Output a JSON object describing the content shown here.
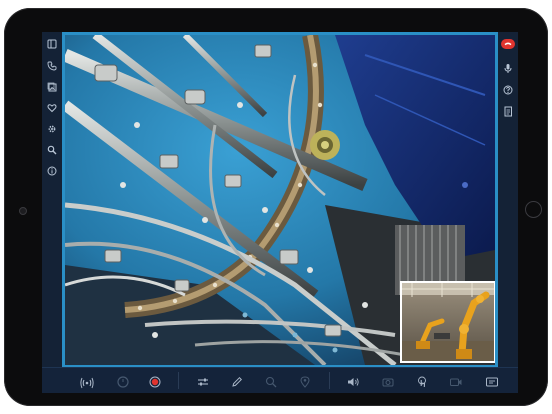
{
  "app": {
    "accent_color": "#2a8fc6",
    "record_color": "#e0342f"
  },
  "left_toolbar": {
    "items": [
      {
        "icon": "sidebar-panel-icon"
      },
      {
        "icon": "phone-icon"
      },
      {
        "icon": "gallery-icon"
      },
      {
        "icon": "heart-icon"
      },
      {
        "icon": "gear-icon"
      },
      {
        "icon": "search-icon"
      },
      {
        "icon": "info-icon"
      }
    ]
  },
  "right_toolbar": {
    "items": [
      {
        "icon": "end-call-icon"
      },
      {
        "icon": "microphone-icon"
      },
      {
        "icon": "help-icon"
      },
      {
        "icon": "document-icon"
      }
    ]
  },
  "bottom_toolbar": {
    "items": [
      {
        "icon": "signal-icon",
        "enabled": true
      },
      {
        "icon": "timer-icon",
        "enabled": false
      },
      {
        "icon": "record-icon",
        "enabled": true
      },
      {
        "icon": "adjustments-icon",
        "enabled": true
      },
      {
        "icon": "pencil-icon",
        "enabled": true
      },
      {
        "icon": "zoom-icon",
        "enabled": false
      },
      {
        "icon": "pin-icon",
        "enabled": false
      },
      {
        "icon": "speaker-icon",
        "enabled": true
      },
      {
        "icon": "camera-icon",
        "enabled": false
      },
      {
        "icon": "touch-icon",
        "enabled": true
      },
      {
        "icon": "video-icon",
        "enabled": false
      },
      {
        "icon": "screen-share-icon",
        "enabled": true
      }
    ]
  }
}
